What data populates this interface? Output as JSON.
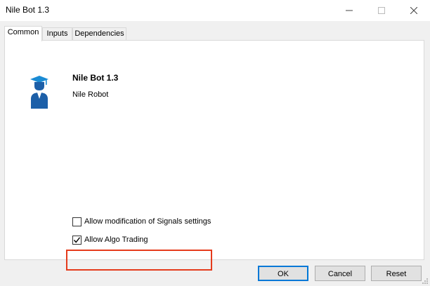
{
  "window": {
    "title": "Nile Bot 1.3",
    "controls": [
      "minimize-icon",
      "maximize-icon",
      "close-icon"
    ]
  },
  "tabs": [
    {
      "label": "Common",
      "active": true
    },
    {
      "label": "Inputs",
      "active": false
    },
    {
      "label": "Dependencies",
      "active": false
    }
  ],
  "app": {
    "name": "Nile Bot 1.3",
    "description": "Nile Robot",
    "icon": "graduate-icon"
  },
  "options": {
    "allow_signals_label": "Allow modification of Signals settings",
    "allow_signals_checked": false,
    "allow_algo_label": "Allow Algo Trading",
    "allow_algo_checked": true
  },
  "buttons": {
    "ok": "OK",
    "cancel": "Cancel",
    "reset": "Reset"
  },
  "colors": {
    "highlight": "#e53b1c",
    "icon_blue": "#1a8bd4",
    "icon_dark": "#1c5fa8"
  }
}
